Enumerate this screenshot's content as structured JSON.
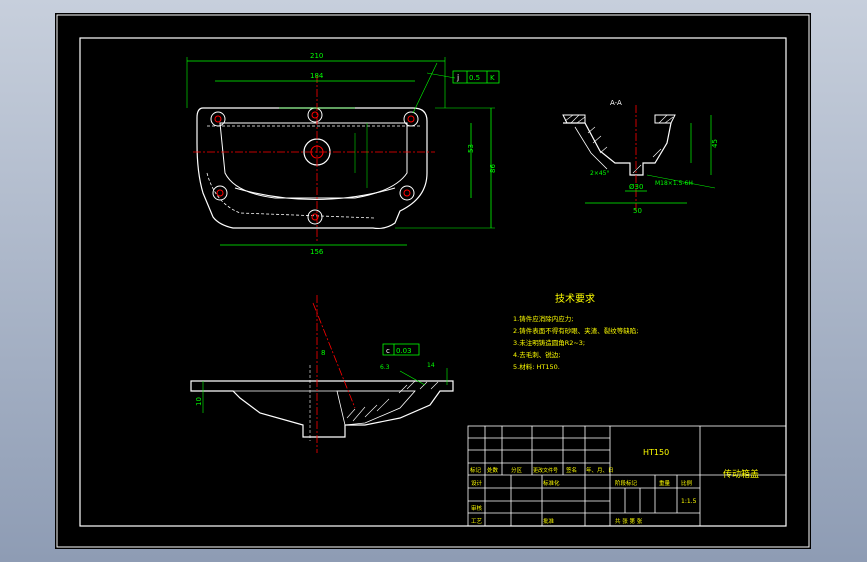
{
  "section_label": "A-A",
  "tech_requirements": {
    "title": "技术要求",
    "items": [
      "1.铸件应消除内应力;",
      "2.铸件表面不得有砂眼、夹渣、裂纹等缺陷;",
      "3.未注明铸造圆角R2~3;",
      "4.去毛刺、锐边;",
      "5.材料: HT150."
    ]
  },
  "title_block": {
    "material": "HT150",
    "part_name": "传动箱盖",
    "scale": "1:1.5",
    "headers": [
      "标记",
      "处数",
      "分区",
      "更改文件号",
      "签名",
      "年、月、日"
    ],
    "row_design": "设计",
    "row_standard": "标准化",
    "row_review": "审核",
    "row_process": "工艺",
    "row_approve": "批准",
    "stage_mark": "阶段标记",
    "weight": "重量",
    "ratio": "比例",
    "sheets": "共  张  第  张"
  },
  "dimensions": {
    "plan_width_total": "210",
    "plan_width_inner": "184",
    "plan_width_bottom": "156",
    "plan_height": "86",
    "plan_height_inner": "53",
    "tolerance_j": "j",
    "tolerance_j_value": "0.5",
    "tolerance_j_datum": "K",
    "tolerance_c": "c",
    "tolerance_c_value": "0.03",
    "section_width": "50",
    "section_depth": "45",
    "section_bore": "Ø30",
    "section_thread": "M18×1.5-6H",
    "section_chamfer": "2×45°",
    "side_angle": "8",
    "side_height": "10",
    "side_r": "6.3",
    "side_l": "14"
  },
  "colors": {
    "outline": "#ffffff",
    "dimension": "#00ff00",
    "text": "#ffff00",
    "centerline": "#ff0000",
    "hidden": "#00ffff"
  }
}
